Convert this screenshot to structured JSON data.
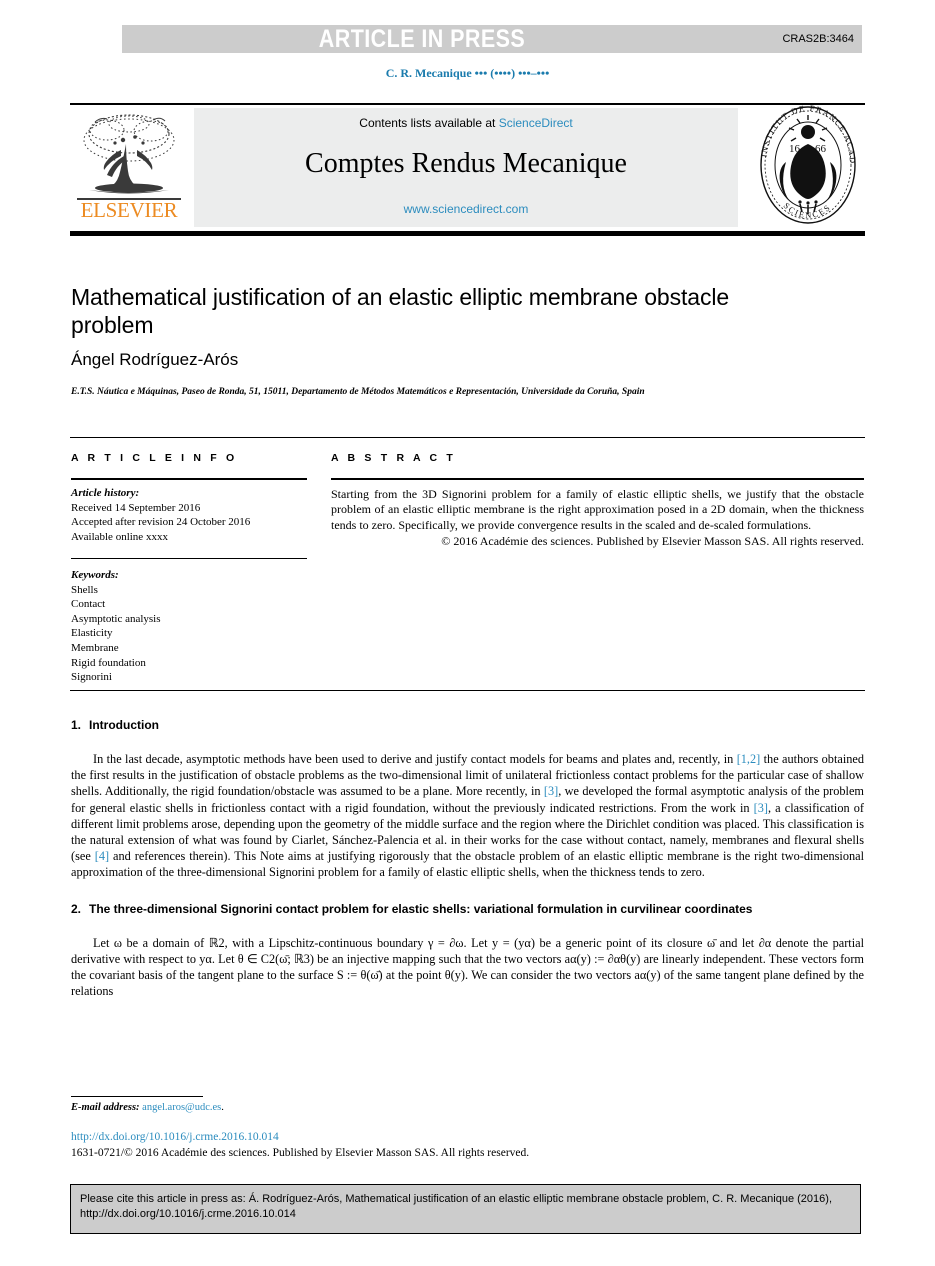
{
  "banner": {
    "label": "ARTICLE IN PRESS",
    "code": "CRAS2B:3464",
    "band_color": "#cccccc"
  },
  "running_head": "C. R. Mecanique ••• (••••) •••–•••",
  "masthead": {
    "contents_prefix": "Contents lists available at ",
    "contents_link": "ScienceDirect",
    "journal_title": "Comptes Rendus Mecanique",
    "url": "www.sciencedirect.com",
    "publisher_logo": "ELSEVIER",
    "seal_text_outer": "INSTITUT DE FRANCE",
    "seal_text_inner": "ACADEMIE DES SCIENCES",
    "seal_year": "1666",
    "link_color": "#2b8cbe",
    "publisher_color": "#ec8b22"
  },
  "article": {
    "title": "Mathematical justification of an elastic elliptic membrane obstacle problem",
    "author": "Ángel Rodríguez-Arós",
    "affiliation": "E.T.S. Náutica e Máquinas, Paseo de Ronda, 51, 15011, Departamento de Métodos Matemáticos e Representación, Universidade da Coruña, Spain"
  },
  "info": {
    "heading": "A R T I C L E   I N F O",
    "history_label": "Article history:",
    "history": [
      "Received 14 September 2016",
      "Accepted after revision 24 October 2016",
      "Available online xxxx"
    ],
    "keywords_label": "Keywords:",
    "keywords": [
      "Shells",
      "Contact",
      "Asymptotic analysis",
      "Elasticity",
      "Membrane",
      "Rigid foundation",
      "Signorini"
    ]
  },
  "abstract": {
    "heading": "A B S T R A C T",
    "text": "Starting from the 3D Signorini problem for a family of elastic elliptic shells, we justify that the obstacle problem of an elastic elliptic membrane is the right approximation posed in a 2D domain, when the thickness tends to zero. Specifically, we provide convergence results in the scaled and de-scaled formulations.",
    "copyright": "© 2016 Académie des sciences. Published by Elsevier Masson SAS. All rights reserved."
  },
  "sections": {
    "intro_number": "1.",
    "intro_title": "Introduction",
    "intro_p1_a": "In the last decade, asymptotic methods have been used to derive and justify contact models for beams and plates and, recently, in ",
    "intro_cite1": "[1,2]",
    "intro_p1_b": " the authors obtained the first results in the justification of obstacle problems as the two-dimensional limit of unilateral frictionless contact problems for the particular case of shallow shells. Additionally, the rigid foundation/obstacle was assumed to be a plane. More recently, in ",
    "intro_cite2": "[3]",
    "intro_p1_c": ", we developed the formal asymptotic analysis of the problem for general elastic shells in frictionless contact with a rigid foundation, without the previously indicated restrictions. From the work in ",
    "intro_cite3": "[3]",
    "intro_p1_d": ", a classification of different limit problems arose, depending upon the geometry of the middle surface and the region where the Dirichlet condition was placed. This classification is the natural extension of what was found by Ciarlet, Sánchez-Palencia et al. in their works for the case without contact, namely, membranes and flexural shells (see ",
    "intro_cite4": "[4]",
    "intro_p1_e": " and references therein). This Note aims at justifying rigorously that the obstacle problem of an elastic elliptic membrane is the right two-dimensional approximation of the three-dimensional Signorini problem for a family of elastic elliptic shells, when the thickness tends to zero.",
    "sec2_number": "2.",
    "sec2_title": "The three-dimensional Signorini contact problem for elastic shells: variational formulation in curvilinear coordinates",
    "sec2_p1": "Let ω be a domain of ℝ2, with a Lipschitz-continuous boundary γ = ∂ω. Let y = (yα) be a generic point of its closure ω̄ and let ∂α denote the partial derivative with respect to yα. Let θ ∈ C2(ω̄; ℝ3) be an injective mapping such that the two vectors aα(y) := ∂αθ(y) are linearly independent. These vectors form the covariant basis of the tangent plane to the surface S := θ(ω̄) at the point θ(y). We can consider the two vectors aα(y) of the same tangent plane defined by the relations"
  },
  "footer": {
    "email_label": "E-mail address:",
    "email": "angel.aros@udc.es",
    "email_suffix": ".",
    "doi": "http://dx.doi.org/10.1016/j.crme.2016.10.014",
    "issn": "1631-0721/© 2016 Académie des sciences. Published by Elsevier Masson SAS. All rights reserved."
  },
  "cite_box": {
    "text": "Please cite this article in press as: Á. Rodríguez-Arós, Mathematical justification of an elastic elliptic membrane obstacle problem, C. R. Mecanique (2016), http://dx.doi.org/10.1016/j.crme.2016.10.014"
  }
}
